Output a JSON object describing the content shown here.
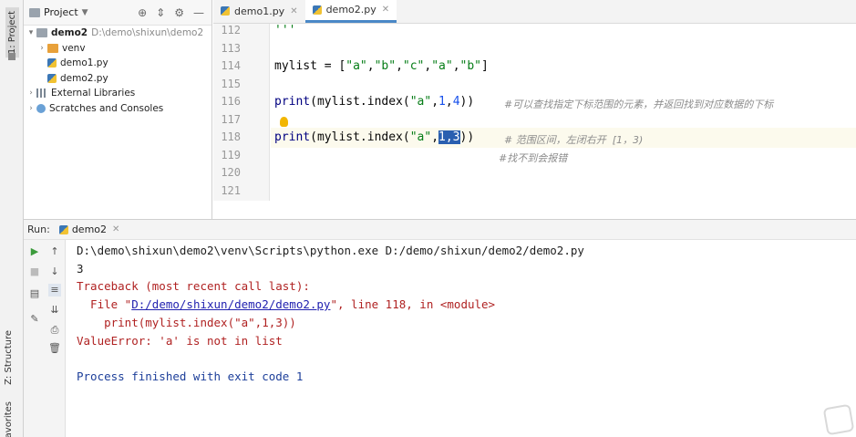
{
  "left_strip": {
    "project_tab": "1: Project",
    "structure_tab": "Z: Structure",
    "favorites_tab": "Favorites"
  },
  "project_panel": {
    "title": "Project",
    "root": {
      "name": "demo2",
      "path": "D:\\demo\\shixun\\demo2"
    },
    "items": [
      {
        "name": "venv"
      },
      {
        "name": "demo1.py"
      },
      {
        "name": "demo2.py"
      },
      {
        "name": "External Libraries"
      },
      {
        "name": "Scratches and Consoles"
      }
    ]
  },
  "editor": {
    "tabs": [
      {
        "label": "demo1.py"
      },
      {
        "label": "demo2.py"
      }
    ],
    "line_numbers": [
      "112",
      "113",
      "114",
      "115",
      "116",
      "117",
      "118",
      "119",
      "120",
      "121"
    ],
    "line112": "'''",
    "line114": {
      "a": "mylist = [",
      "s1": "\"a\"",
      "c1": ",",
      "s2": "\"b\"",
      "c2": ",",
      "s3": "\"c\"",
      "c3": ",",
      "s4": "\"a\"",
      "c4": ",",
      "s5": "\"b\"",
      "b": "]"
    },
    "line116": {
      "fn": "print",
      "a": "(mylist.index(",
      "s": "\"a\"",
      "c1": ",",
      "n1": "1",
      "c2": ",",
      "n2": "4",
      "b": "))",
      "comment": "#可以查找指定下标范围的元素，并返回找到对应数据的下标"
    },
    "line118": {
      "fn": "print",
      "a": "(mylist.index(",
      "s": "\"a\"",
      "c1": ",",
      "sel": "1,3",
      "b": "))",
      "comment": "# 范围区间，左闭右开  [1，3)"
    },
    "line119": {
      "comment": "#找不到会报错"
    }
  },
  "run_panel": {
    "run_label": "Run:",
    "tab_label": "demo2",
    "console": {
      "cmd": "D:\\demo\\shixun\\demo2\\venv\\Scripts\\python.exe D:/demo/shixun/demo2/demo2.py",
      "out1": "3",
      "tb_header": "Traceback (most recent call last):",
      "tb_file_pre": "  File \"",
      "tb_file_link": "D:/demo/shixun/demo2/demo2.py",
      "tb_file_post": "\", line 118, in <module>",
      "tb_code": "    print(mylist.index(\"a\",1,3))",
      "error": "ValueError: 'a' is not in list",
      "finished": "Process finished with exit code 1"
    }
  },
  "icons": [
    "run-icon",
    "stop-icon",
    "up-arrow-icon",
    "down-arrow-icon",
    "soft-wrap-icon",
    "scroll-to-end-icon",
    "print-icon",
    "trash-icon",
    "pin-icon",
    "layout-icon",
    "lightbulb-icon",
    "target-icon",
    "collapse-icon",
    "gear-icon",
    "minimize-icon"
  ],
  "colors": {
    "accent": "#4a88c7",
    "error": "#b02222",
    "string": "#067d17",
    "number": "#1750eb",
    "selection": "#2a5fb0"
  }
}
